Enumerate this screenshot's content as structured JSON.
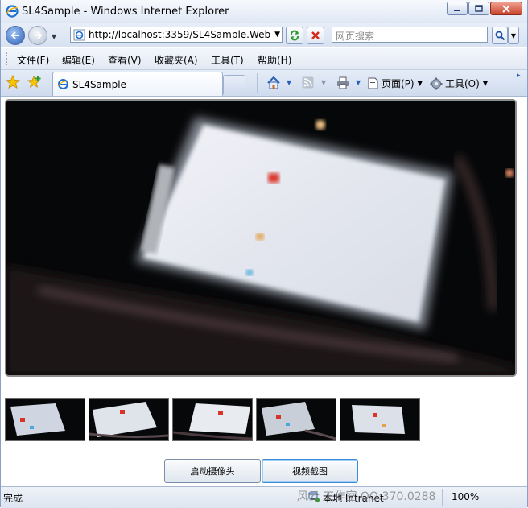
{
  "window": {
    "title": "SL4Sample - Windows Internet Explorer",
    "minimize_label": "0",
    "maximize_label": "1",
    "close_label": "r"
  },
  "address_bar": {
    "url": "http://localhost:3359/SL4Sample.Web/Sl",
    "search_placeholder": "网页搜索"
  },
  "menu": {
    "items": [
      "文件(F)",
      "编辑(E)",
      "查看(V)",
      "收藏夹(A)",
      "工具(T)",
      "帮助(H)"
    ]
  },
  "tabs": {
    "active_tab_label": "SL4Sample"
  },
  "command_bar": {
    "page_label": "页面(P)",
    "tools_label": "工具(O)"
  },
  "app": {
    "start_camera_label": "启动摄像头",
    "capture_label": "视频截图",
    "thumbnail_count": 5
  },
  "status": {
    "text": "完成",
    "zone_label": "本地 Intranet",
    "zoom_label": "100%"
  },
  "watermark": "风云 工作室 QQ:370.0288"
}
